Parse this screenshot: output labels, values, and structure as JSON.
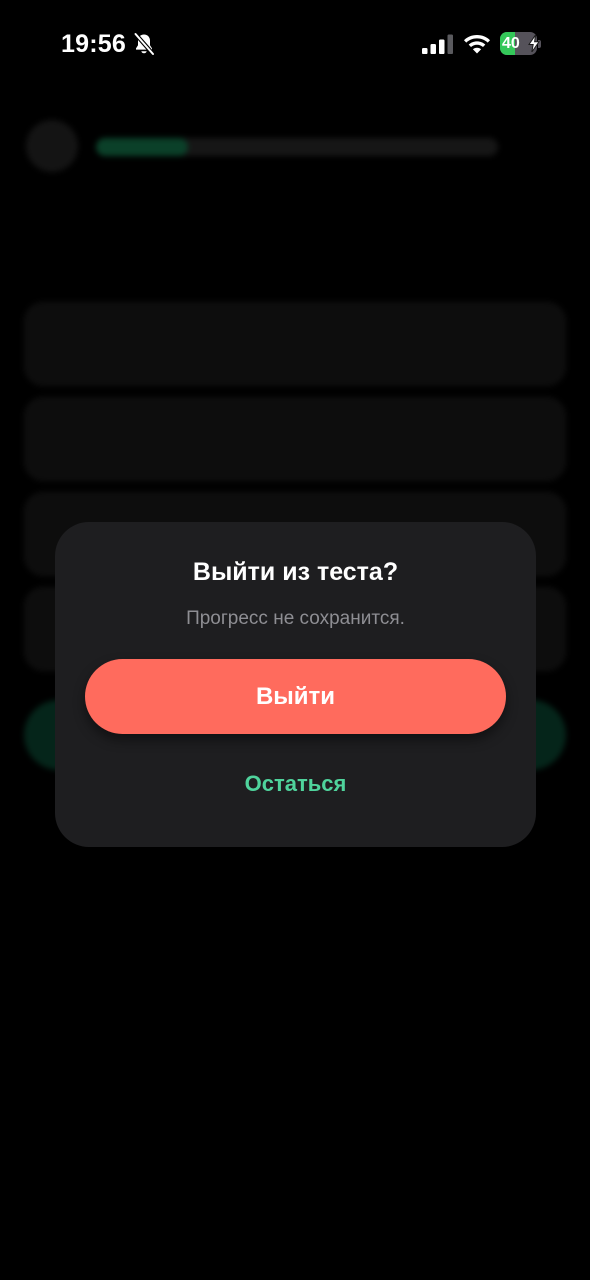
{
  "status_bar": {
    "time": "19:56",
    "battery_percent": "40",
    "battery_level": 0.4,
    "icons": [
      "bell-slash-icon",
      "cellular-signal-icon",
      "wifi-icon",
      "battery-charging-icon"
    ]
  },
  "dialog": {
    "title": "Выйти из теста?",
    "message": "Прогресс не сохранится.",
    "exit_label": "Выйти",
    "stay_label": "Остаться"
  },
  "colors": {
    "background": "#000000",
    "dialog_bg": "#1e1e20",
    "exit_button": "#ff6b5d",
    "stay_text": "#4fd39c",
    "message_text": "#8e8e93"
  },
  "background_screen": {
    "progress_fraction": 0.23
  }
}
